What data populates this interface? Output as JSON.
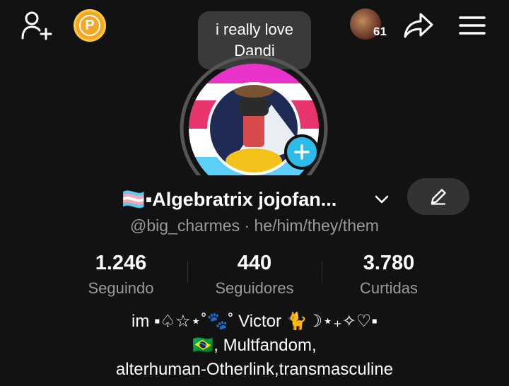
{
  "header": {
    "add_user_icon": "person-plus-icon",
    "coin_letter": "P",
    "notification_count": "61",
    "share_icon": "share-arrow-icon",
    "menu_icon": "hamburger-menu-icon"
  },
  "note_bubble": {
    "line1": "i really love",
    "line2": "Dandi"
  },
  "profile": {
    "display_name": "🏳️‍⚧️▪Algebratrix jojofan...",
    "handle_line": "@big_charmes · he/him/they/them"
  },
  "stats": [
    {
      "value": "1.246",
      "label": "Seguindo"
    },
    {
      "value": "440",
      "label": "Seguidores"
    },
    {
      "value": "3.780",
      "label": "Curtidas"
    }
  ],
  "bio": {
    "line1": "im ▪♤☆⋆˚🐾˚ Victor 🐈☽⋆₊✧♡▪",
    "line2": "🇧🇷, Multfandom,",
    "line3": "alterhuman-Otherlink,transmasculine"
  },
  "colors": {
    "background": "#121212",
    "coin": "#f5a623",
    "add_story": "#2dbbe9",
    "edit_button_bg": "#333333",
    "secondary_text": "#9a9a9a",
    "trans_pink": "#f5a9b8",
    "trans_blue": "#5bcefa",
    "ring_magenta": "#e832c9"
  }
}
